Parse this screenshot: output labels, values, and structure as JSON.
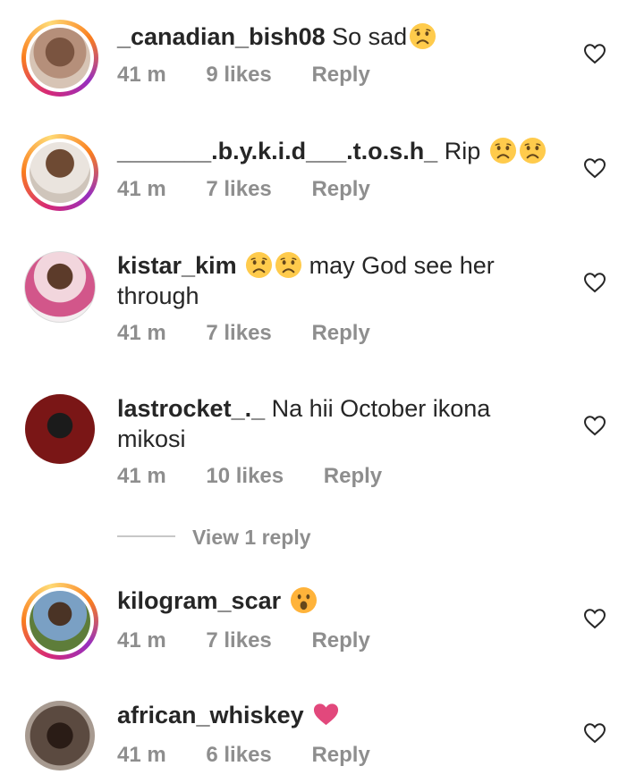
{
  "comments": [
    {
      "username": "_canadian_bish08",
      "text": "So sad",
      "emoji": "sad-face-emoji",
      "time": "41 m",
      "likes": "9 likes",
      "reply": "Reply",
      "story": true,
      "avatar_color": "#5a3a2b"
    },
    {
      "username": "_______.b.y.k.i.d___.t.o.s.h_",
      "text": "Rip",
      "emoji": "sad-face-emoji x2",
      "time": "41 m",
      "likes": "7 likes",
      "reply": "Reply",
      "story": true,
      "avatar_color": "#c9b8a6"
    },
    {
      "username": "kistar_kim",
      "text_line1": "may God see her",
      "text_line2": "through",
      "emoji": "sad-face-emoji x2",
      "time": "41 m",
      "likes": "7 likes",
      "reply": "Reply",
      "story": false,
      "avatar_color": "#e89ab5"
    },
    {
      "username": "lastrocket_._",
      "text_line1": "Na hii October ikona",
      "text_line2": "mikosi",
      "time": "41 m",
      "likes": "10 likes",
      "reply": "Reply",
      "story": false,
      "avatar_color": "#6b1a1a"
    },
    {
      "username": "kilogram_scar",
      "emoji": "surprised-face-emoji",
      "time": "41 m",
      "likes": "7 likes",
      "reply": "Reply",
      "story": true,
      "avatar_color": "#3b5d2e"
    },
    {
      "username": "african_whiskey",
      "emoji": "pink-heart-emoji",
      "time": "41 m",
      "likes": "6 likes",
      "reply": "Reply",
      "story": false,
      "avatar_color": "#3a2a22"
    }
  ],
  "view_replies": "View 1 reply",
  "colors": {
    "text": "#262626",
    "meta": "#8e8e8e",
    "emoji_yellow": "#ffcb4c",
    "heart_pink": "#e2487c"
  }
}
